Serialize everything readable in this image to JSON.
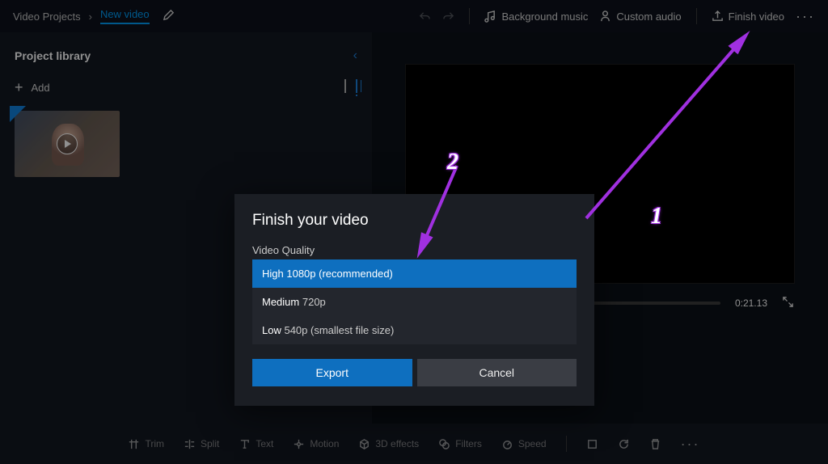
{
  "breadcrumb": {
    "root": "Video Projects",
    "current": "New video"
  },
  "topbar": {
    "bgmusic": "Background music",
    "customaudio": "Custom audio",
    "finish": "Finish video"
  },
  "sidebar": {
    "title": "Project library",
    "add": "Add"
  },
  "timeline": {
    "timestamp": "0:21.13"
  },
  "bottombar": {
    "trim": "Trim",
    "split": "Split",
    "text": "Text",
    "motion": "Motion",
    "effects": "3D effects",
    "filters": "Filters",
    "speed": "Speed"
  },
  "dialog": {
    "title": "Finish your video",
    "label": "Video Quality",
    "options": [
      {
        "bold": "High",
        "rest": " 1080p (recommended)"
      },
      {
        "bold": "Medium",
        "rest": " 720p"
      },
      {
        "bold": "Low",
        "rest": " 540p (smallest file size)"
      }
    ],
    "export": "Export",
    "cancel": "Cancel"
  },
  "annotations": {
    "n1": "1",
    "n2": "2"
  }
}
